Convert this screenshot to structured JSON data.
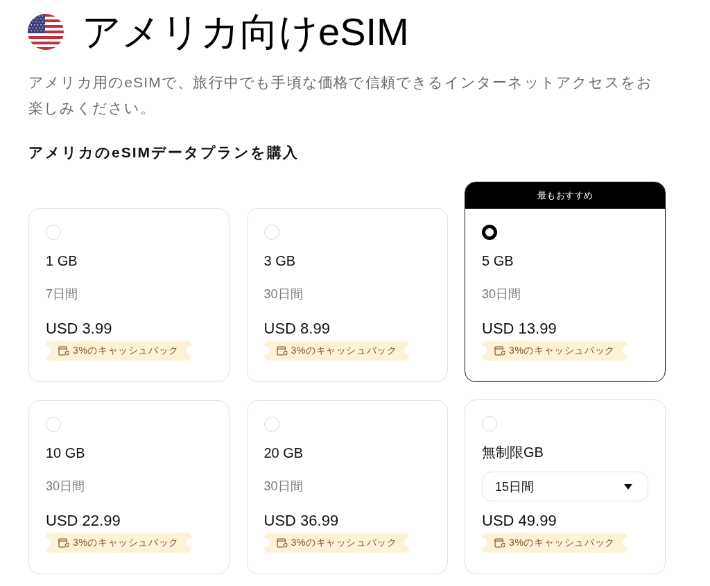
{
  "header": {
    "title": "アメリカ向けeSIM",
    "description": "アメリカ用のeSIMで、旅行中でも手頃な価格で信頼できるインターネットアクセスをお楽しみください。",
    "section_heading": "アメリカのeSIMデータプランを購入"
  },
  "plans": [
    {
      "kind": "fixed",
      "data": "1 GB",
      "duration": "7日間",
      "price": "USD 3.99",
      "cashback": "3%のキャッシュバック",
      "selected": false
    },
    {
      "kind": "fixed",
      "data": "3 GB",
      "duration": "30日間",
      "price": "USD 8.99",
      "cashback": "3%のキャッシュバック",
      "selected": false
    },
    {
      "kind": "fixed",
      "ribbon": "最もおすすめ",
      "data": "5 GB",
      "duration": "30日間",
      "price": "USD 13.99",
      "cashback": "3%のキャッシュバック",
      "selected": true
    },
    {
      "kind": "fixed",
      "data": "10 GB",
      "duration": "30日間",
      "price": "USD 22.99",
      "cashback": "3%のキャッシュバック",
      "selected": false
    },
    {
      "kind": "fixed",
      "data": "20 GB",
      "duration": "30日間",
      "price": "USD 36.99",
      "cashback": "3%のキャッシュバック",
      "selected": false
    },
    {
      "kind": "dropdown",
      "data": "無制限GB",
      "duration": "15日間",
      "price": "USD 49.99",
      "cashback": "3%のキャッシュバック",
      "selected": false
    }
  ]
}
